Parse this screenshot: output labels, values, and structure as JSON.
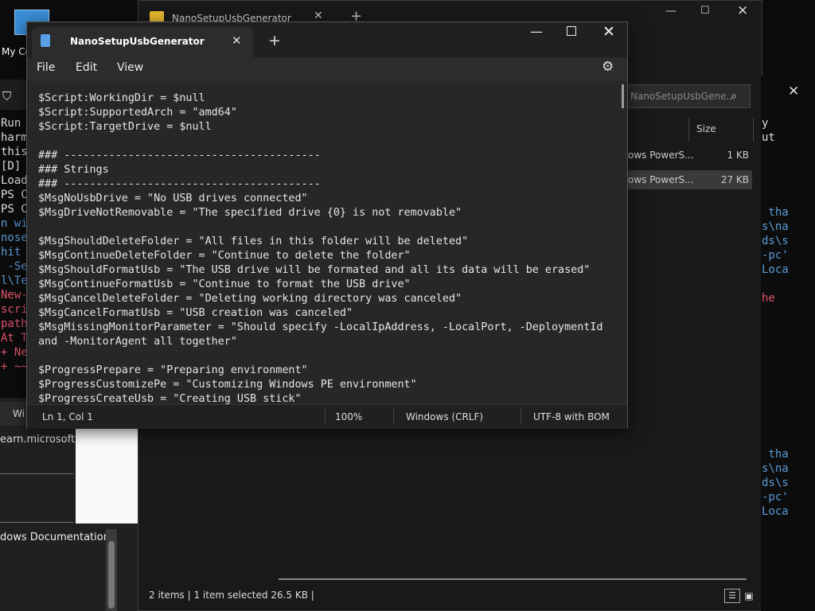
{
  "desktop": {
    "icon_label": "My Co"
  },
  "terminal_left": {
    "lines": [
      {
        "text": "Run",
        "color": "#dddddd"
      },
      {
        "text": "harm",
        "color": "#dddddd"
      },
      {
        "text": "this",
        "color": "#dddddd"
      },
      {
        "text": "[D]",
        "color": "#dddddd"
      },
      {
        "text": "Load",
        "color": "#dddddd"
      },
      {
        "text": "PS C",
        "color": "#dddddd"
      },
      {
        "text": "PS C",
        "color": "#dddddd"
      },
      {
        "text": "n wi",
        "color": "#5b9bd5"
      },
      {
        "text": "nose",
        "color": "#5b9bd5"
      },
      {
        "text": "hit",
        "color": "#5b9bd5"
      },
      {
        "text": " -Se",
        "color": "#5b9bd5"
      },
      {
        "text": "l\\Te",
        "color": "#5b9bd5"
      },
      {
        "text": "New-",
        "color": "#e0546b"
      },
      {
        "text": "scri",
        "color": "#e0546b"
      },
      {
        "text": "path",
        "color": "#e0546b"
      },
      {
        "text": "At T",
        "color": "#e0546b"
      },
      {
        "text": "+ Ne",
        "color": "#e0546b"
      },
      {
        "text": "+ ~~",
        "color": "#e0546b"
      }
    ]
  },
  "browser": {
    "tab_label": "Wi",
    "url": "earn.microsoft.c",
    "doc_label": "dows Documentation"
  },
  "explorer": {
    "tab_title": "NanoSetupUsbGenerator",
    "search_placeholder": "NanoSetupUsbGene...",
    "column_size": "Size",
    "rows": [
      {
        "type": "ows PowerS...",
        "size": "1 KB"
      },
      {
        "type": "ows PowerS...",
        "size": "27 KB"
      }
    ],
    "status": "2 items  |  1 item selected  26.5 KB  |"
  },
  "terminal_right": {
    "top_lines": [
      {
        "text": "y",
        "color": "#dddddd"
      },
      {
        "text": "ut",
        "color": "#dddddd"
      }
    ],
    "block1": [
      {
        "text": " tha",
        "color": "#5b9bd5"
      },
      {
        "text": "s\\na",
        "color": "#5b9bd5"
      },
      {
        "text": "ds\\s",
        "color": "#5b9bd5"
      },
      {
        "text": "-pc'",
        "color": "#5b9bd5"
      },
      {
        "text": "Loca",
        "color": "#5b9bd5"
      },
      {
        "text": "",
        "color": "#dddddd"
      },
      {
        "text": "he",
        "color": "#e0546b"
      }
    ],
    "block2": [
      {
        "text": " tha",
        "color": "#5b9bd5"
      },
      {
        "text": "s\\na",
        "color": "#5b9bd5"
      },
      {
        "text": "ds\\s",
        "color": "#5b9bd5"
      },
      {
        "text": "-pc'",
        "color": "#5b9bd5"
      },
      {
        "text": "Loca",
        "color": "#5b9bd5"
      }
    ]
  },
  "notepad": {
    "title": "NanoSetupUsbGenerator",
    "menu": [
      "File",
      "Edit",
      "View"
    ],
    "code": [
      "$Script:WorkingDir = $null",
      "$Script:SupportedArch = \"amd64\"",
      "$Script:TargetDrive = $null",
      "",
      "### ----------------------------------------",
      "### Strings",
      "### ----------------------------------------",
      "$MsgNoUsbDrive = \"No USB drives connected\"",
      "$MsgDriveNotRemovable = \"The specified drive {0} is not removable\"",
      "",
      "$MsgShouldDeleteFolder = \"All files in this folder will be deleted\"",
      "$MsgContinueDeleteFolder = \"Continue to delete the folder\"",
      "$MsgShouldFormatUsb = \"The USB drive will be formated and all its data will be erased\"",
      "$MsgContinueFormatUsb = \"Continue to format the USB drive\"",
      "$MsgCancelDeleteFolder = \"Deleting working directory was canceled\"",
      "$MsgCancelFormatUsb = \"USB creation was canceled\"",
      "$MsgMissingMonitorParameter = \"Should specify -LocalIpAddress, -LocalPort, -DeploymentId",
      "and -MonitorAgent all together\"",
      "",
      "$ProgressPrepare = \"Preparing environment\"",
      "$ProgressCustomizePe = \"Customizing Windows PE environment\"",
      "$ProgressCreateUsb = \"Creating USB stick\""
    ],
    "status": {
      "position": "Ln 1, Col 1",
      "zoom": "100%",
      "line_ending": "Windows (CRLF)",
      "encoding": "UTF-8 with BOM"
    }
  }
}
